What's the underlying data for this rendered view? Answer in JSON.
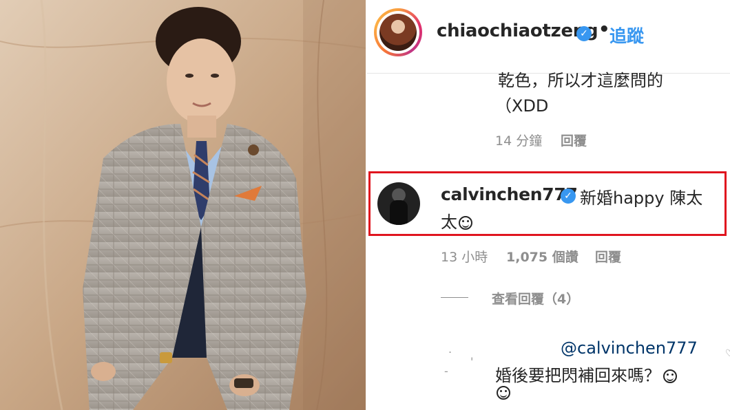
{
  "header": {
    "username": "chiaochiaotzeng",
    "separator": "•",
    "follow_label": "追蹤"
  },
  "previous_comment": {
    "text_line1": "乾色，所以才這麼問的",
    "text_line2": "（XDD",
    "time": "14 分鐘",
    "reply_label": "回覆"
  },
  "highlighted_comment": {
    "username": "calvinchen777",
    "text_line1": "新婚happy 陳太",
    "text_line2": "太",
    "time": "13 小時",
    "likes": "1,075 個讚",
    "reply_label": "回覆",
    "highlight_color": "#e0141e"
  },
  "view_replies": {
    "label": "查看回覆（4）"
  },
  "reply": {
    "mention": "@calvinchen777",
    "text": "婚後要把閃補回來嗎？"
  },
  "colors": {
    "accent": "#3897f0",
    "text": "#262626",
    "muted": "#8e8e8e",
    "mention": "#003569"
  },
  "icons": [
    "verified-badge-icon",
    "smiling-emoji-icon",
    "grinning-emoji-icon"
  ]
}
